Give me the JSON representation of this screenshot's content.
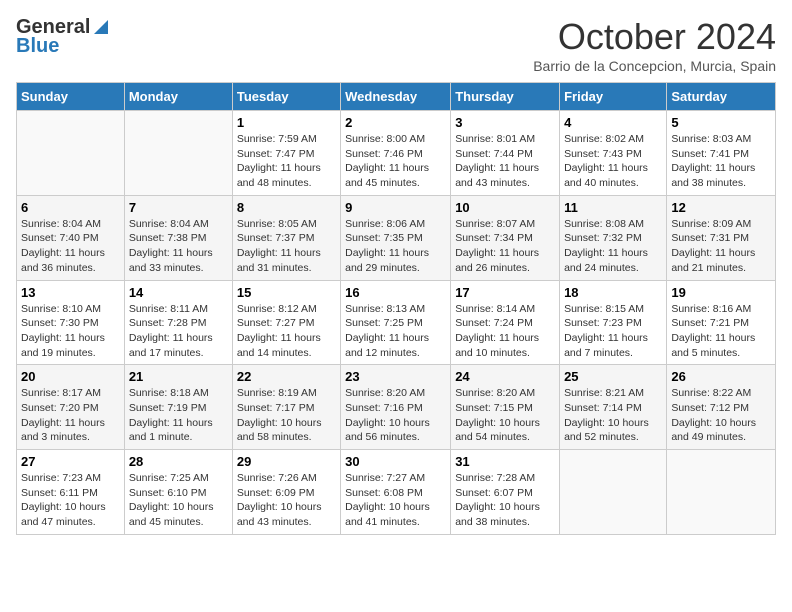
{
  "logo": {
    "general": "General",
    "blue": "Blue"
  },
  "title": "October 2024",
  "subtitle": "Barrio de la Concepcion, Murcia, Spain",
  "days_of_week": [
    "Sunday",
    "Monday",
    "Tuesday",
    "Wednesday",
    "Thursday",
    "Friday",
    "Saturday"
  ],
  "weeks": [
    [
      {
        "day": "",
        "info": ""
      },
      {
        "day": "",
        "info": ""
      },
      {
        "day": "1",
        "info": "Sunrise: 7:59 AM\nSunset: 7:47 PM\nDaylight: 11 hours and 48 minutes."
      },
      {
        "day": "2",
        "info": "Sunrise: 8:00 AM\nSunset: 7:46 PM\nDaylight: 11 hours and 45 minutes."
      },
      {
        "day": "3",
        "info": "Sunrise: 8:01 AM\nSunset: 7:44 PM\nDaylight: 11 hours and 43 minutes."
      },
      {
        "day": "4",
        "info": "Sunrise: 8:02 AM\nSunset: 7:43 PM\nDaylight: 11 hours and 40 minutes."
      },
      {
        "day": "5",
        "info": "Sunrise: 8:03 AM\nSunset: 7:41 PM\nDaylight: 11 hours and 38 minutes."
      }
    ],
    [
      {
        "day": "6",
        "info": "Sunrise: 8:04 AM\nSunset: 7:40 PM\nDaylight: 11 hours and 36 minutes."
      },
      {
        "day": "7",
        "info": "Sunrise: 8:04 AM\nSunset: 7:38 PM\nDaylight: 11 hours and 33 minutes."
      },
      {
        "day": "8",
        "info": "Sunrise: 8:05 AM\nSunset: 7:37 PM\nDaylight: 11 hours and 31 minutes."
      },
      {
        "day": "9",
        "info": "Sunrise: 8:06 AM\nSunset: 7:35 PM\nDaylight: 11 hours and 29 minutes."
      },
      {
        "day": "10",
        "info": "Sunrise: 8:07 AM\nSunset: 7:34 PM\nDaylight: 11 hours and 26 minutes."
      },
      {
        "day": "11",
        "info": "Sunrise: 8:08 AM\nSunset: 7:32 PM\nDaylight: 11 hours and 24 minutes."
      },
      {
        "day": "12",
        "info": "Sunrise: 8:09 AM\nSunset: 7:31 PM\nDaylight: 11 hours and 21 minutes."
      }
    ],
    [
      {
        "day": "13",
        "info": "Sunrise: 8:10 AM\nSunset: 7:30 PM\nDaylight: 11 hours and 19 minutes."
      },
      {
        "day": "14",
        "info": "Sunrise: 8:11 AM\nSunset: 7:28 PM\nDaylight: 11 hours and 17 minutes."
      },
      {
        "day": "15",
        "info": "Sunrise: 8:12 AM\nSunset: 7:27 PM\nDaylight: 11 hours and 14 minutes."
      },
      {
        "day": "16",
        "info": "Sunrise: 8:13 AM\nSunset: 7:25 PM\nDaylight: 11 hours and 12 minutes."
      },
      {
        "day": "17",
        "info": "Sunrise: 8:14 AM\nSunset: 7:24 PM\nDaylight: 11 hours and 10 minutes."
      },
      {
        "day": "18",
        "info": "Sunrise: 8:15 AM\nSunset: 7:23 PM\nDaylight: 11 hours and 7 minutes."
      },
      {
        "day": "19",
        "info": "Sunrise: 8:16 AM\nSunset: 7:21 PM\nDaylight: 11 hours and 5 minutes."
      }
    ],
    [
      {
        "day": "20",
        "info": "Sunrise: 8:17 AM\nSunset: 7:20 PM\nDaylight: 11 hours and 3 minutes."
      },
      {
        "day": "21",
        "info": "Sunrise: 8:18 AM\nSunset: 7:19 PM\nDaylight: 11 hours and 1 minute."
      },
      {
        "day": "22",
        "info": "Sunrise: 8:19 AM\nSunset: 7:17 PM\nDaylight: 10 hours and 58 minutes."
      },
      {
        "day": "23",
        "info": "Sunrise: 8:20 AM\nSunset: 7:16 PM\nDaylight: 10 hours and 56 minutes."
      },
      {
        "day": "24",
        "info": "Sunrise: 8:20 AM\nSunset: 7:15 PM\nDaylight: 10 hours and 54 minutes."
      },
      {
        "day": "25",
        "info": "Sunrise: 8:21 AM\nSunset: 7:14 PM\nDaylight: 10 hours and 52 minutes."
      },
      {
        "day": "26",
        "info": "Sunrise: 8:22 AM\nSunset: 7:12 PM\nDaylight: 10 hours and 49 minutes."
      }
    ],
    [
      {
        "day": "27",
        "info": "Sunrise: 7:23 AM\nSunset: 6:11 PM\nDaylight: 10 hours and 47 minutes."
      },
      {
        "day": "28",
        "info": "Sunrise: 7:25 AM\nSunset: 6:10 PM\nDaylight: 10 hours and 45 minutes."
      },
      {
        "day": "29",
        "info": "Sunrise: 7:26 AM\nSunset: 6:09 PM\nDaylight: 10 hours and 43 minutes."
      },
      {
        "day": "30",
        "info": "Sunrise: 7:27 AM\nSunset: 6:08 PM\nDaylight: 10 hours and 41 minutes."
      },
      {
        "day": "31",
        "info": "Sunrise: 7:28 AM\nSunset: 6:07 PM\nDaylight: 10 hours and 38 minutes."
      },
      {
        "day": "",
        "info": ""
      },
      {
        "day": "",
        "info": ""
      }
    ]
  ]
}
